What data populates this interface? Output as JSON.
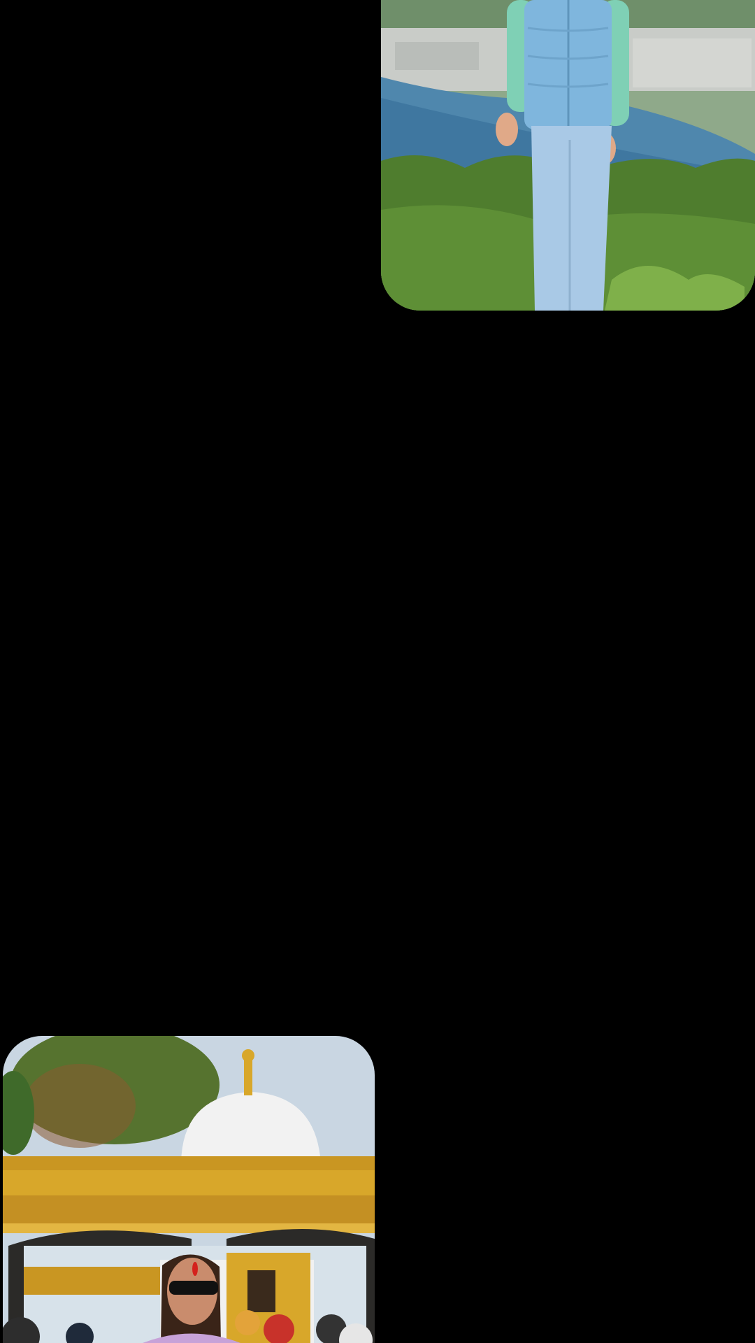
{
  "screen": {
    "background_color": "#000000"
  },
  "photos": [
    {
      "id_name": "photo-card-lakeside-viewpoint",
      "icon": "image-icon",
      "accent_colors": [
        "#7fb6dd",
        "#4a7fa8",
        "#5f8f3a",
        "#a9c9e6"
      ]
    },
    {
      "id_name": "photo-card-golden-temple-gate",
      "icon": "image-icon",
      "accent_colors": [
        "#d8a72a",
        "#f2f2f2",
        "#b5c7d8",
        "#c8322a"
      ]
    }
  ]
}
